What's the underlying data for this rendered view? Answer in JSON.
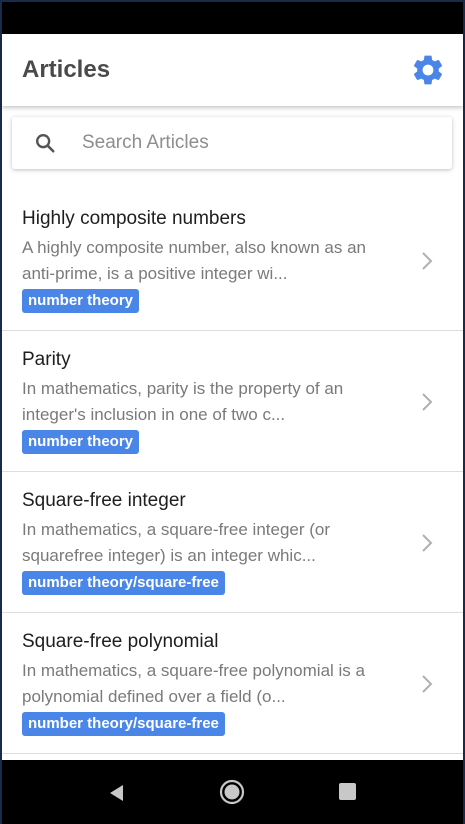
{
  "app_bar": {
    "title": "Articles",
    "settings_icon": "gear-icon",
    "accent_color": "#4a86e8"
  },
  "search": {
    "placeholder": "Search Articles",
    "value": "",
    "icon": "search-icon"
  },
  "articles": [
    {
      "title": "Highly composite numbers",
      "description": "A highly composite number, also known as an anti-prime, is a positive integer wi...",
      "tag": "number theory"
    },
    {
      "title": "Parity",
      "description": "In mathematics, parity is the property of an integer's inclusion in one of two c...",
      "tag": "number theory"
    },
    {
      "title": "Square-free integer",
      "description": "In mathematics, a square-free integer (or squarefree integer) is an integer whic...",
      "tag": "number theory/square-free"
    },
    {
      "title": "Square-free polynomial",
      "description": "In mathematics, a square-free polynomial is a polynomial defined over a field (o...",
      "tag": "number theory/square-free"
    }
  ],
  "nav_bar": {
    "back_icon": "back-triangle-icon",
    "home_icon": "home-circle-icon",
    "recents_icon": "recents-square-icon"
  }
}
